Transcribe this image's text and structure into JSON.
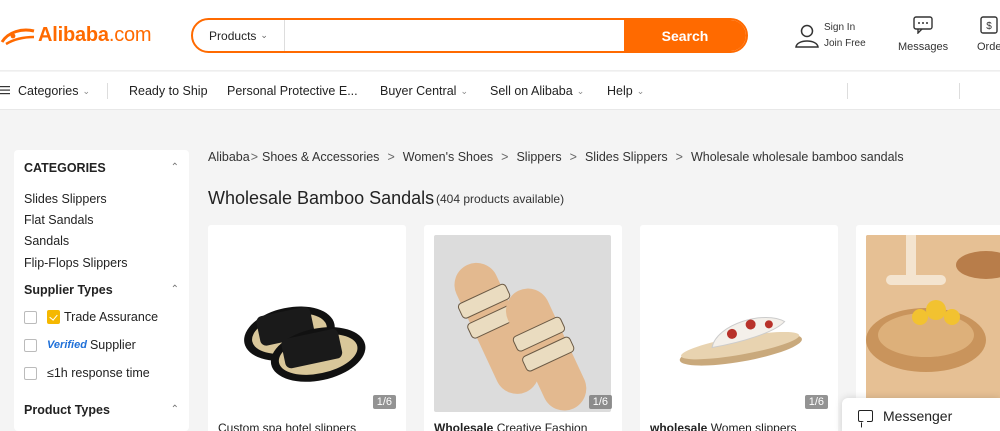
{
  "header": {
    "logo_text": "Alibaba",
    "logo_suffix": ".com",
    "search": {
      "category": "Products",
      "placeholder": "",
      "button_label": "Search"
    },
    "signin_label": "Sign In",
    "join_label": "Join Free",
    "messages_label": "Messages",
    "orders_label": "Orde",
    "brand_color": "#ff6a00"
  },
  "nav": {
    "categories": "Categories",
    "ready_to_ship": "Ready to Ship",
    "ppe": "Personal Protective E...",
    "buyer_central": "Buyer Central",
    "sell_on_alibaba": "Sell on Alibaba",
    "help": "Help"
  },
  "sidebar": {
    "categories_heading": "CATEGORIES",
    "categories": [
      "Slides Slippers",
      "Flat Sandals",
      "Sandals",
      "Flip-Flops Slippers"
    ],
    "supplier_types_heading": "Supplier Types",
    "trade_assurance": "Trade Assurance",
    "verified_badge": "Verified",
    "verified_supplier": "Supplier",
    "response_time": "≤1h response time",
    "product_types_heading": "Product Types"
  },
  "breadcrumb": {
    "items": [
      "Alibaba",
      "Shoes & Accessories",
      "Women's Shoes",
      "Slippers",
      "Slides Slippers",
      "Wholesale wholesale bamboo sandals"
    ]
  },
  "main": {
    "title": "Wholesale Bamboo Sandals",
    "count": "(404 products available)"
  },
  "products": [
    {
      "badge": "1/6",
      "title_bold": "",
      "title": "Custom spa hotel slippers"
    },
    {
      "badge": "1/6",
      "title_bold": "Wholesale",
      "title": " Creative Fashion"
    },
    {
      "badge": "1/6",
      "title_bold": "wholesale",
      "title": " Women slippers"
    },
    {
      "badge": "",
      "title_bold": "",
      "title": ""
    }
  ],
  "messenger": {
    "label": "Messenger"
  }
}
